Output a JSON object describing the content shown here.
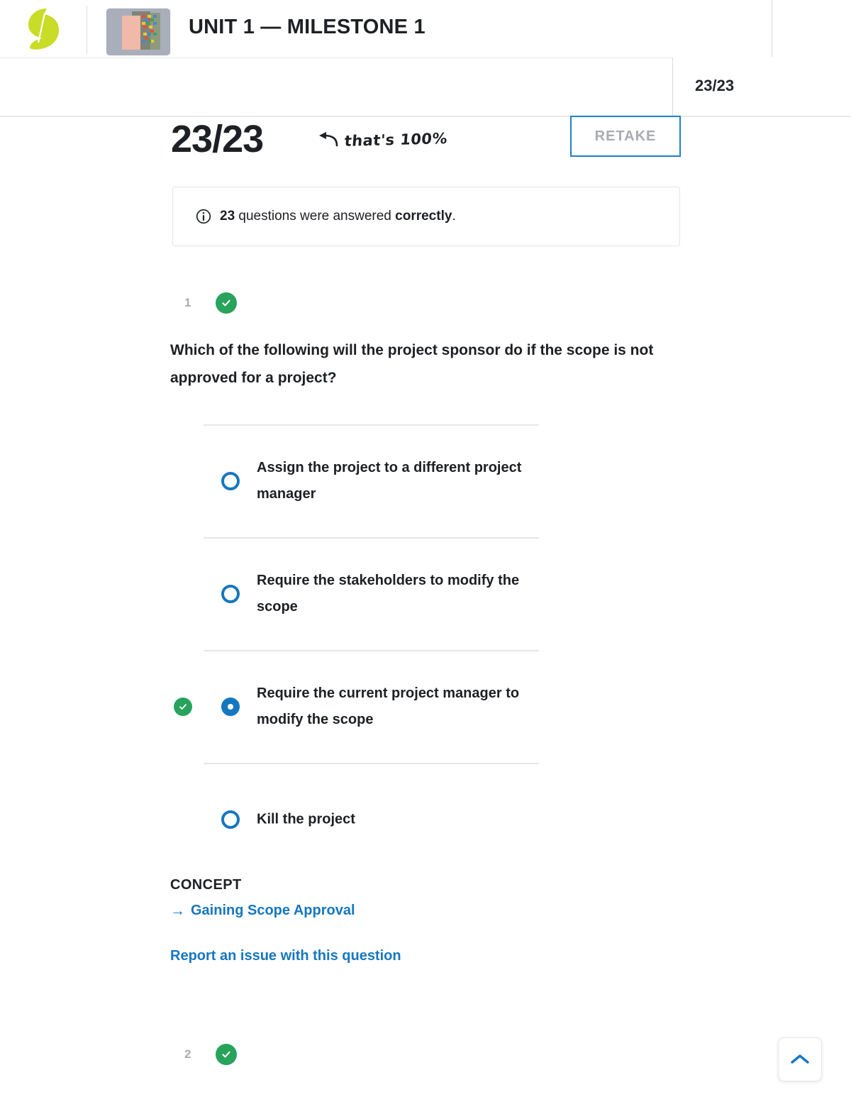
{
  "header": {
    "logo_name": "sophia-logo",
    "thumbnail_alt": "course-thumbnail",
    "title": "UNIT 1 — MILESTONE 1",
    "score_compact": "23/23"
  },
  "score_panel": {
    "score": "23/23",
    "handwritten_note": "that's 100%",
    "retake_label": "RETAKE"
  },
  "info_banner": {
    "count": "23",
    "text_middle": " questions were answered ",
    "emphasis": "correctly",
    "suffix": ".",
    "icon": "info-circle-icon"
  },
  "question": {
    "number": "1",
    "status": "correct",
    "prompt": "Which of the following will the project sponsor do if the scope is not approved for a project?",
    "options": [
      {
        "label": "Assign the project to a different project manager",
        "selected": false,
        "correct": false
      },
      {
        "label": "Require the stakeholders to modify the scope",
        "selected": false,
        "correct": false
      },
      {
        "label": "Require the current project manager to modify the scope",
        "selected": true,
        "correct": true
      },
      {
        "label": "Kill the project",
        "selected": false,
        "correct": false
      }
    ],
    "concept_label": "CONCEPT",
    "concept_link": "Gaining Scope Approval",
    "report_link": "Report an issue with this question"
  },
  "next_question": {
    "number": "2",
    "status": "correct"
  },
  "scroll_top": {
    "icon": "chevron-up-icon"
  },
  "colors": {
    "accent_blue": "#1577c0",
    "correct_green": "#27a35c",
    "logo_green": "#c8dc28",
    "text_dark": "#1d2024",
    "muted": "#a9adb2"
  }
}
